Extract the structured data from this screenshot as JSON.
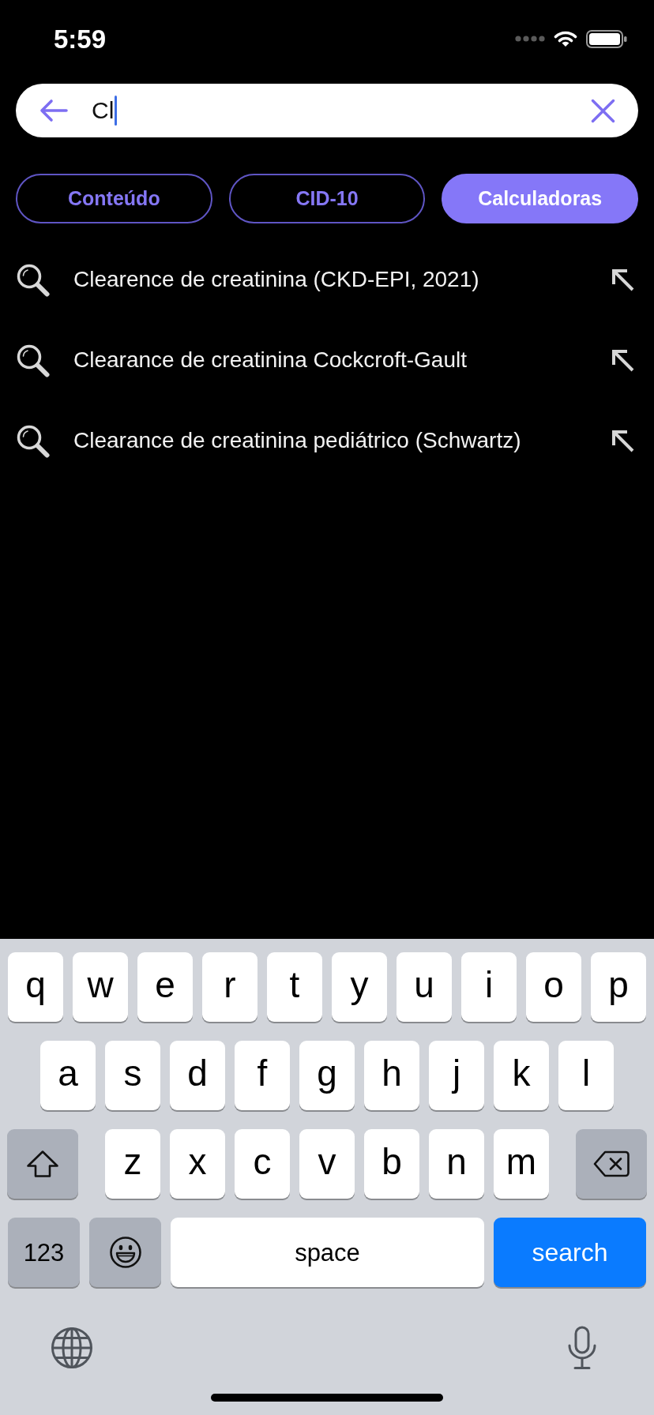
{
  "status_bar": {
    "time": "5:59"
  },
  "search": {
    "value": "Cl"
  },
  "tabs": [
    {
      "label": "Conteúdo",
      "selected": false
    },
    {
      "label": "CID-10",
      "selected": false
    },
    {
      "label": "Calculadoras",
      "selected": true
    }
  ],
  "suggestions": [
    {
      "text": "Clearence de creatinina (CKD-EPI, 2021)"
    },
    {
      "text": "Clearance de creatinina Cockcroft-Gault"
    },
    {
      "text": "Clearance de creatinina pediátrico (Schwartz)"
    }
  ],
  "keyboard": {
    "rows": [
      {
        "keys": [
          {
            "kind": "letter",
            "label": "q"
          },
          {
            "kind": "letter",
            "label": "w"
          },
          {
            "kind": "letter",
            "label": "e"
          },
          {
            "kind": "letter",
            "label": "r"
          },
          {
            "kind": "letter",
            "label": "t"
          },
          {
            "kind": "letter",
            "label": "y"
          },
          {
            "kind": "letter",
            "label": "u"
          },
          {
            "kind": "letter",
            "label": "i"
          },
          {
            "kind": "letter",
            "label": "o"
          },
          {
            "kind": "letter",
            "label": "p"
          }
        ]
      },
      {
        "keys": [
          {
            "kind": "letter",
            "label": "a"
          },
          {
            "kind": "letter",
            "label": "s"
          },
          {
            "kind": "letter",
            "label": "d"
          },
          {
            "kind": "letter",
            "label": "f"
          },
          {
            "kind": "letter",
            "label": "g"
          },
          {
            "kind": "letter",
            "label": "h"
          },
          {
            "kind": "letter",
            "label": "j"
          },
          {
            "kind": "letter",
            "label": "k"
          },
          {
            "kind": "letter",
            "label": "l"
          }
        ]
      },
      {
        "keys": [
          {
            "kind": "shift"
          },
          {
            "kind": "letter",
            "label": "z"
          },
          {
            "kind": "letter",
            "label": "x"
          },
          {
            "kind": "letter",
            "label": "c"
          },
          {
            "kind": "letter",
            "label": "v"
          },
          {
            "kind": "letter",
            "label": "b"
          },
          {
            "kind": "letter",
            "label": "n"
          },
          {
            "kind": "letter",
            "label": "m"
          },
          {
            "kind": "delete"
          }
        ]
      },
      {
        "keys": [
          {
            "kind": "mode",
            "label": "123"
          },
          {
            "kind": "emoji"
          },
          {
            "kind": "space",
            "label": "space"
          },
          {
            "kind": "action",
            "label": "search"
          }
        ]
      }
    ]
  }
}
